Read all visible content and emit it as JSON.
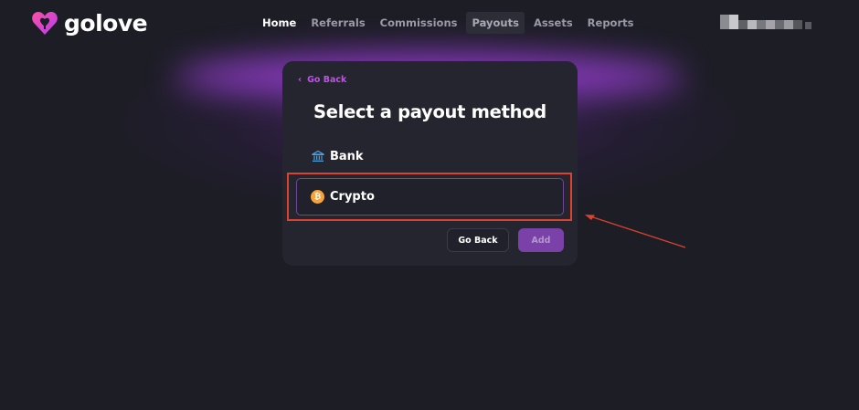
{
  "brand": {
    "name": "golove",
    "accent": "#d946b8"
  },
  "nav": {
    "items": [
      {
        "label": "Home",
        "state": "current"
      },
      {
        "label": "Referrals",
        "state": "default"
      },
      {
        "label": "Commissions",
        "state": "default"
      },
      {
        "label": "Payouts",
        "state": "active"
      },
      {
        "label": "Assets",
        "state": "default"
      },
      {
        "label": "Reports",
        "state": "default"
      }
    ]
  },
  "user": {
    "icon": "blurred-user-info"
  },
  "card": {
    "back_link": "Go Back",
    "title": "Select a payout method",
    "options": [
      {
        "label": "Bank",
        "icon": "bank-icon"
      },
      {
        "label": "Crypto",
        "icon": "bitcoin-icon",
        "selected": true
      }
    ],
    "buttons": {
      "back": "Go Back",
      "add": "Add"
    }
  },
  "colors": {
    "background": "#1c1d25",
    "card": "#24252e",
    "accent_purple": "#c052e6",
    "add_button": "#7a42a8",
    "annotation_red": "#d9432f"
  }
}
